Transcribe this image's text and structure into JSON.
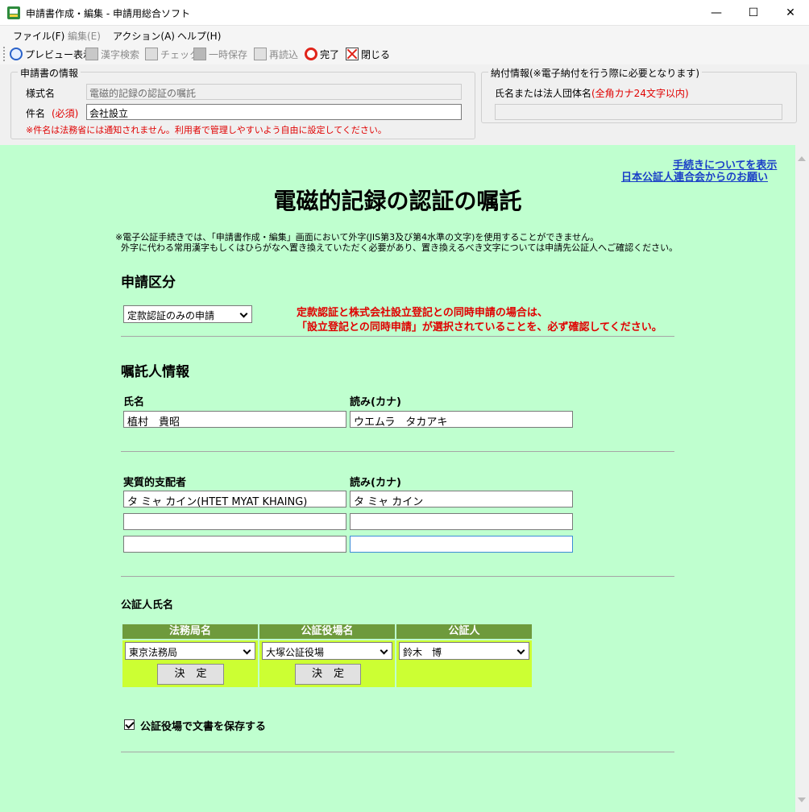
{
  "window": {
    "title": "申請書作成・編集 - 申請用総合ソフト"
  },
  "menu": {
    "file": "ファイル(F)",
    "edit": "編集(E)",
    "action": "アクション(A)",
    "help": "ヘルプ(H)"
  },
  "toolbar": {
    "preview": "プレビュー表示",
    "kanji": "漢字検索",
    "check": "チェック",
    "temp_save": "一時保存",
    "reload": "再読込",
    "done": "完了",
    "close": "閉じる"
  },
  "app_info": {
    "legend": "申請書の情報",
    "form_label": "様式名",
    "form_value": "電磁的記録の認証の嘱託",
    "subject_label": "件名",
    "required": "(必須)",
    "subject_value": "会社設立",
    "note": "※件名は法務省には通知されません。利用者で管理しやすいよう自由に設定してください。"
  },
  "payment": {
    "legend": "納付情報(※電子納付を行う際に必要となります)",
    "name_label": "氏名または法人団体名",
    "name_hint": "(全角カナ24文字以内)",
    "name_value": ""
  },
  "links": {
    "procedure": "手続きについてを表示",
    "notice": "日本公証人連合会からのお願い"
  },
  "page": {
    "title": "電磁的記録の認証の嘱託",
    "note1": "※電子公証手続きでは、「申請書作成・編集」画面において外字(JIS第3及び第4水準の文字)を使用することができません。",
    "note2": "外字に代わる常用漢字もしくはひらがなへ置き換えていただく必要があり、置き換えるべき文字については申請先公証人へご確認ください。"
  },
  "application": {
    "heading": "申請区分",
    "selected": "定款認証のみの申請",
    "warn1": "定款認証と株式会社設立登記との同時申請の場合は、",
    "warn2": "「設立登記との同時申請」が選択されていることを、必ず確認してください。"
  },
  "client": {
    "heading": "嘱託人情報",
    "name_label": "氏名",
    "reading_label": "読み(カナ)",
    "name": "植村　貴昭",
    "reading": "ウエムラ　タカアキ"
  },
  "owner": {
    "label": "実質的支配者",
    "reading_label": "読み(カナ)",
    "rows": [
      {
        "name": "タ ミャ カイン(HTET MYAT KHAING)",
        "reading": "タ ミャ カイン"
      },
      {
        "name": "",
        "reading": ""
      },
      {
        "name": "",
        "reading": ""
      }
    ]
  },
  "notary": {
    "heading": "公証人氏名",
    "col_bureau": "法務局名",
    "col_office": "公証役場名",
    "col_notary": "公証人",
    "bureau": "東京法務局",
    "office": "大塚公証役場",
    "person": "鈴木　博",
    "decide": "決定"
  },
  "save_option": {
    "label": "公証役場で文書を保存する",
    "checked": true
  }
}
